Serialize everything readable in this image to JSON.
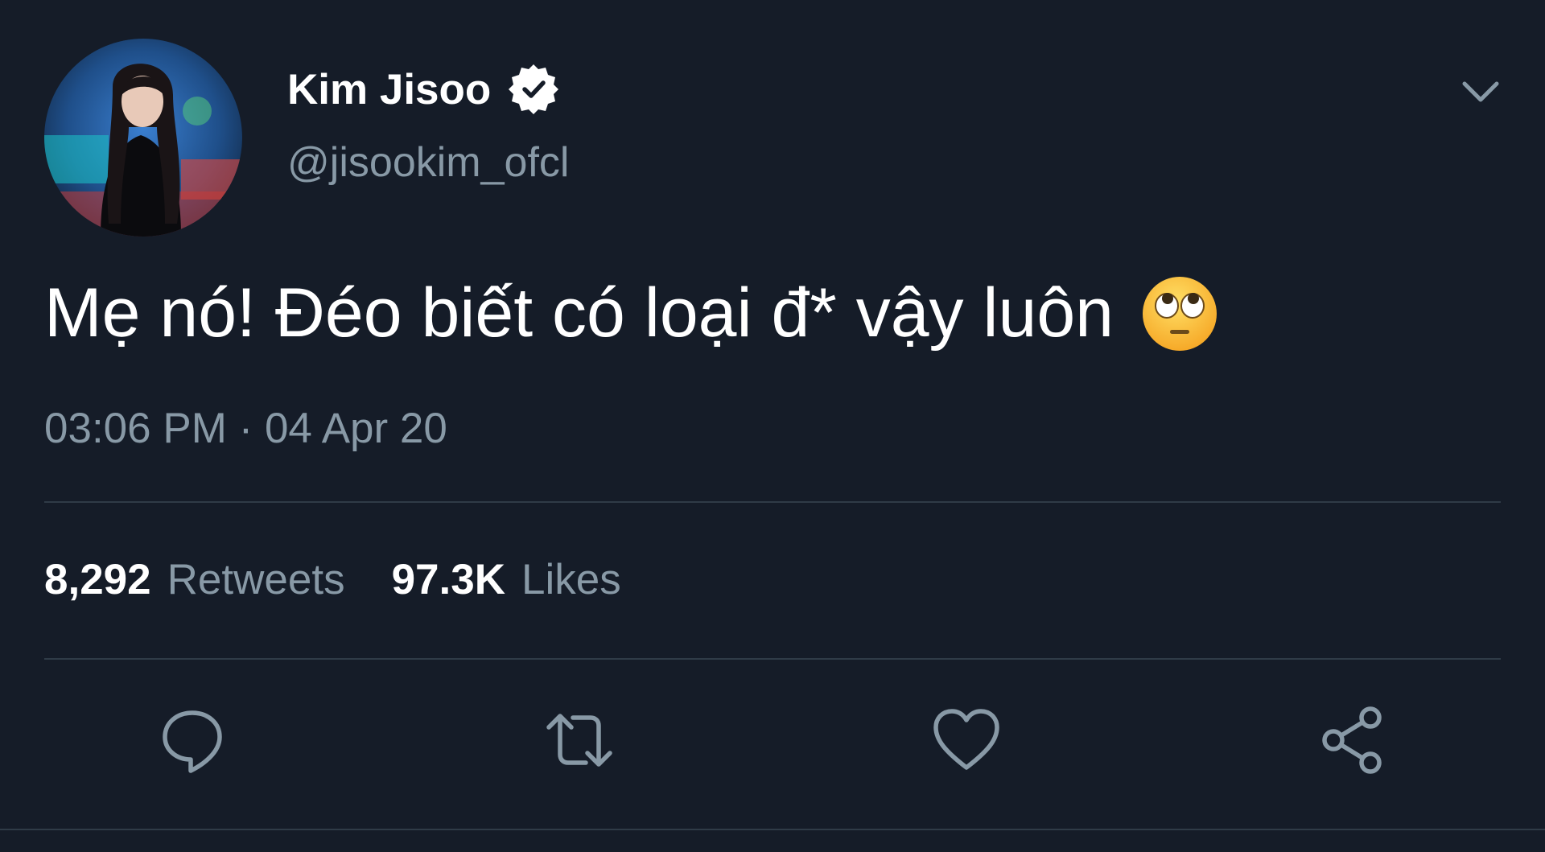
{
  "tweet": {
    "display_name": "Kim Jisoo",
    "verified": true,
    "handle": "@jisookim_ofcl",
    "text": "Mẹ nó! Đéo biết có loại đ* vậy luôn",
    "emoji": "face-with-rolling-eyes",
    "timestamp": "03:06 PM · 04 Apr 20",
    "stats": {
      "retweets_count": "8,292",
      "retweets_label": "Retweets",
      "likes_count": "97.3K",
      "likes_label": "Likes"
    }
  },
  "icons": {
    "verified": "verified-badge-icon",
    "caret": "chevron-down-icon",
    "reply": "reply-icon",
    "retweet": "retweet-icon",
    "like": "heart-icon",
    "share": "share-icon"
  },
  "colors": {
    "background": "#151c28",
    "primary_text": "#ffffff",
    "secondary_text": "#8899a6",
    "divider": "#2f3b47"
  }
}
